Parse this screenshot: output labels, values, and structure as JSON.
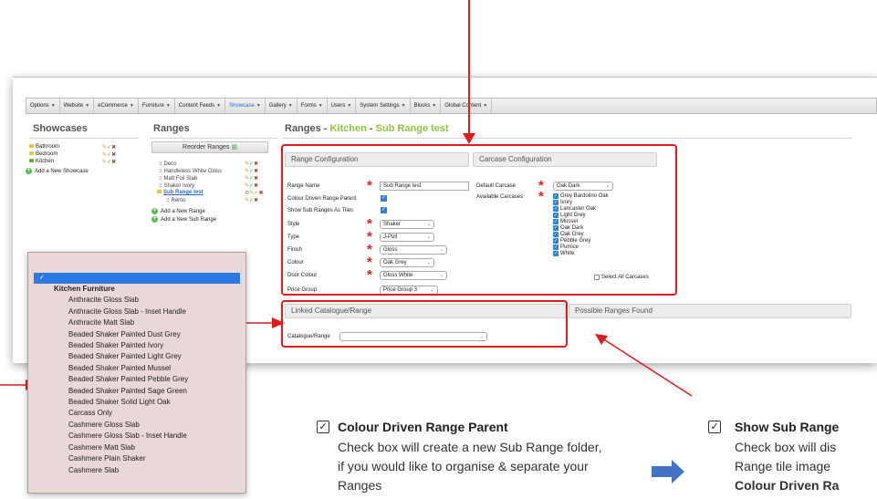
{
  "menubar": {
    "items": [
      {
        "label": "Options",
        "active": false
      },
      {
        "label": "Website",
        "active": false
      },
      {
        "label": "eCommerce",
        "active": false
      },
      {
        "label": "Furniture",
        "active": false
      },
      {
        "label": "Content Feeds",
        "active": false
      },
      {
        "label": "Showcase",
        "active": true
      },
      {
        "label": "Gallery",
        "active": false
      },
      {
        "label": "Forms",
        "active": false
      },
      {
        "label": "Users",
        "active": false
      },
      {
        "label": "System Settings",
        "active": false
      },
      {
        "label": "Blocks",
        "active": false
      },
      {
        "label": "Global Content",
        "active": false
      }
    ]
  },
  "showcases": {
    "title": "Showcases",
    "items": [
      "Bathroom",
      "Bedroom",
      "Kitchen"
    ],
    "add_label": "Add a New Showcase"
  },
  "ranges": {
    "title": "Ranges",
    "reorder_label": "Reorder Ranges",
    "items": [
      {
        "label": "Deco"
      },
      {
        "label": "Handleless White Gloss"
      },
      {
        "label": "Matt Foil Slab"
      },
      {
        "label": "Shaker Ivory"
      },
      {
        "label": "Sub Range test"
      },
      {
        "label": "Remo"
      }
    ],
    "add_range_label": "Add a New Range",
    "add_sub_range_label": "Add a New Sub Range"
  },
  "detail": {
    "title_prefix": "Ranges - ",
    "title_mid": "Kitchen",
    "title_sep": " - ",
    "title_suffix": "Sub Range test",
    "range_config_head": "Range Configuration",
    "carcase_config_head": "Carcase Configuration",
    "fields": {
      "range_name_label": "Range Name",
      "range_name_value": "Sub Range test",
      "colour_driven_label": "Colour Driven Range Parent",
      "show_sub_tiles_label": "Show Sub Ranges As Tiles",
      "style_label": "Style",
      "style_value": "Shaker",
      "type_label": "Type",
      "type_value": "J-Pull",
      "finish_label": "Finish",
      "finish_value": "Gloss",
      "colour_label": "Colour",
      "colour_value": "Oak Grey",
      "door_colour_label": "Door Colour",
      "door_colour_value": "Gloss White",
      "price_group_label": "Price Group",
      "price_group_value": "Price Group 3"
    },
    "carcase": {
      "default_label": "Default Carcase",
      "default_value": "Oak Dark",
      "available_label": "Available Carcases",
      "available": [
        "Grey Bardolino Oak",
        "Ivory",
        "Lancaster Oak",
        "Light Grey",
        "Mussel",
        "Oak Dark",
        "Oak Grey",
        "Pebble Grey",
        "Pumice",
        "White"
      ],
      "select_all_label": "Select All Carcases"
    },
    "linked_head": "Linked Catalogue/Range",
    "possible_head": "Possible Ranges Found",
    "catalogue_label": "Catalogue/Range"
  },
  "dropdown": {
    "selected_mark": "✓",
    "group": "Kitchen Furniture",
    "options": [
      "Anthracite Gloss Slab",
      "Anthracite Gloss Slab - Inset Handle",
      "Anthracite Matt Slab",
      "Beaded Shaker Painted Dust Grey",
      "Beaded Shaker Painted Ivory",
      "Beaded Shaker Painted Light Grey",
      "Beaded Shaker Painted Mussel",
      "Beaded Shaker Painted Pebble Grey",
      "Beaded Shaker Painted Sage Green",
      "Beaded Shaker Solid Light Oak",
      "Carcass Only",
      "Cashmere Gloss Slab",
      "Cashmere Gloss Slab - Inset Handle",
      "Cashmere Matt Slab",
      "Cashmere Plain Shaker",
      "Cashmere Slab"
    ]
  },
  "notes": {
    "left_title": "Colour Driven Range Parent",
    "left_body": "Check box will create a new Sub Range folder, if you would like to organise & separate your Ranges",
    "right_title": "Show Sub Range",
    "right_body_1": "Check box will dis",
    "right_body_2": "Range tile image",
    "right_body_3": "Colour Driven Ra"
  },
  "colors": {
    "accent_red": "#e11b1b",
    "accent_green": "#8cc63e",
    "checkbox_blue": "#2f7fe0",
    "arrow_blue": "#4472c4"
  }
}
